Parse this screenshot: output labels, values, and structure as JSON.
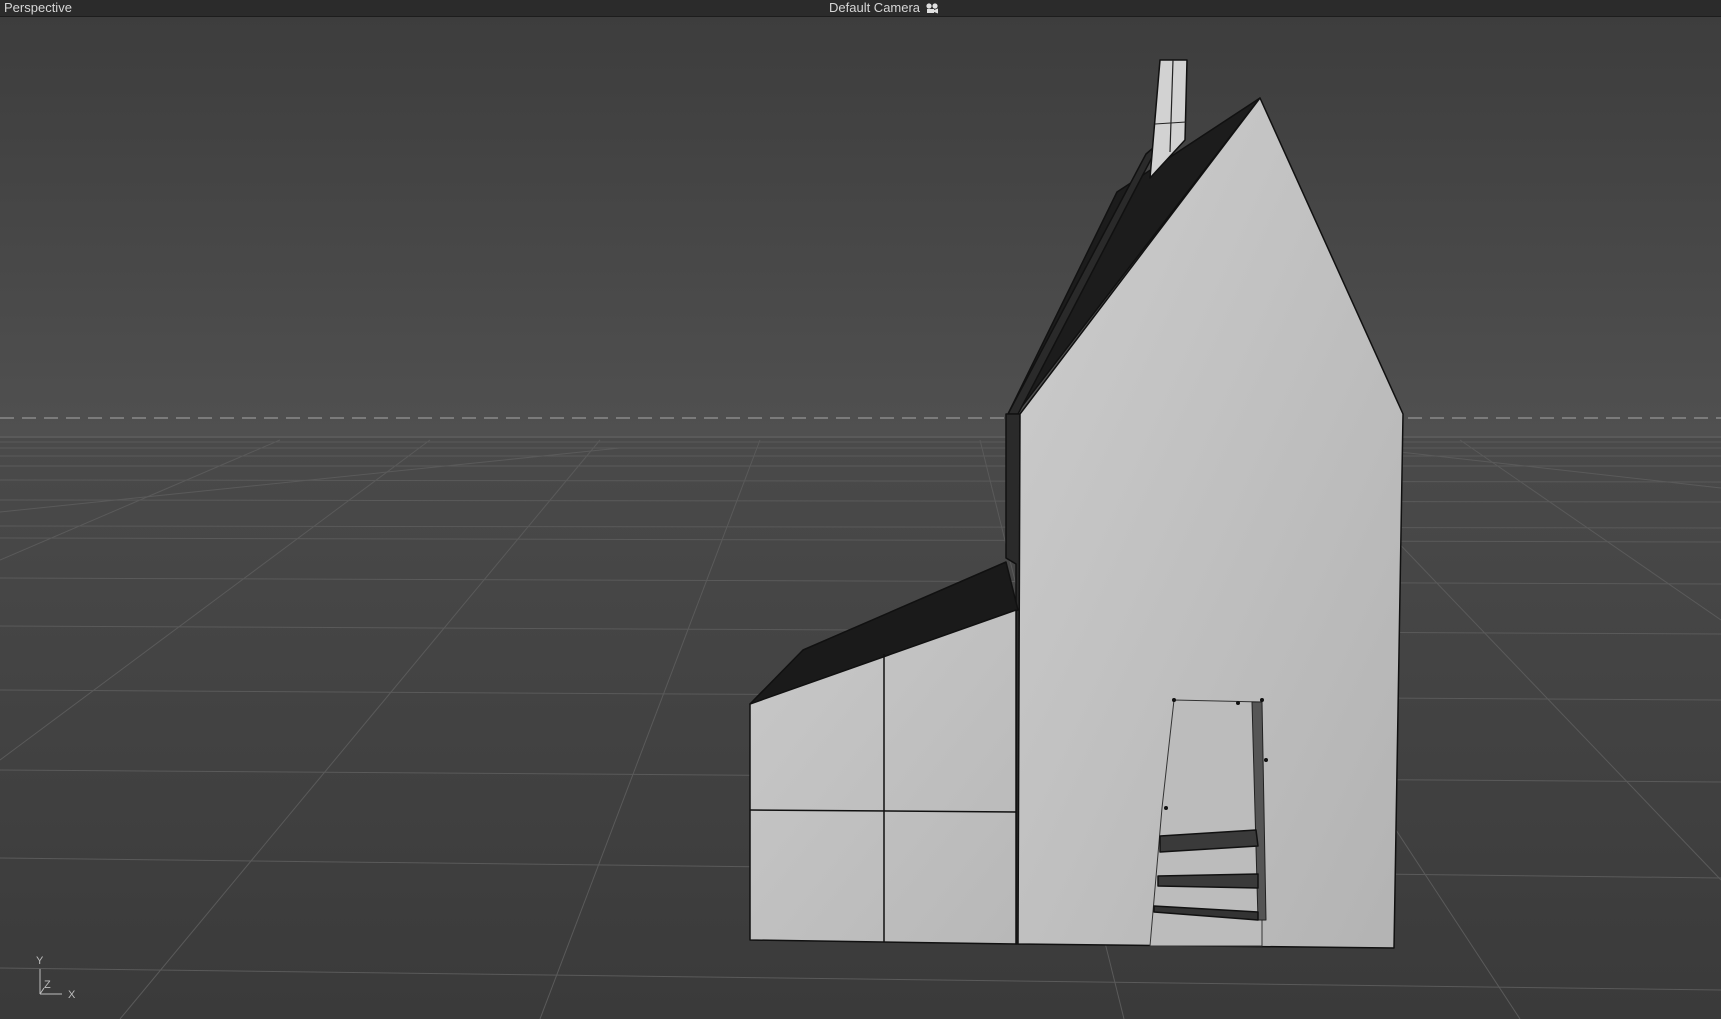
{
  "viewport": {
    "view_mode": "Perspective",
    "camera": {
      "label": "Default Camera",
      "icon": "camera-icon"
    },
    "axis_gizmo": {
      "y": "Y",
      "z": "Z",
      "x": "X"
    }
  },
  "colors": {
    "background_sky": "#4c4c4c",
    "background_floor": "#3e3e3e",
    "grid_line": "#555555",
    "horizon_dash": "#8a8a8a",
    "wall_light": "#c4c4c4",
    "wall_shade": "#b0b0b0",
    "roof_dark": "#1f1f1f",
    "edge": "#111111"
  }
}
